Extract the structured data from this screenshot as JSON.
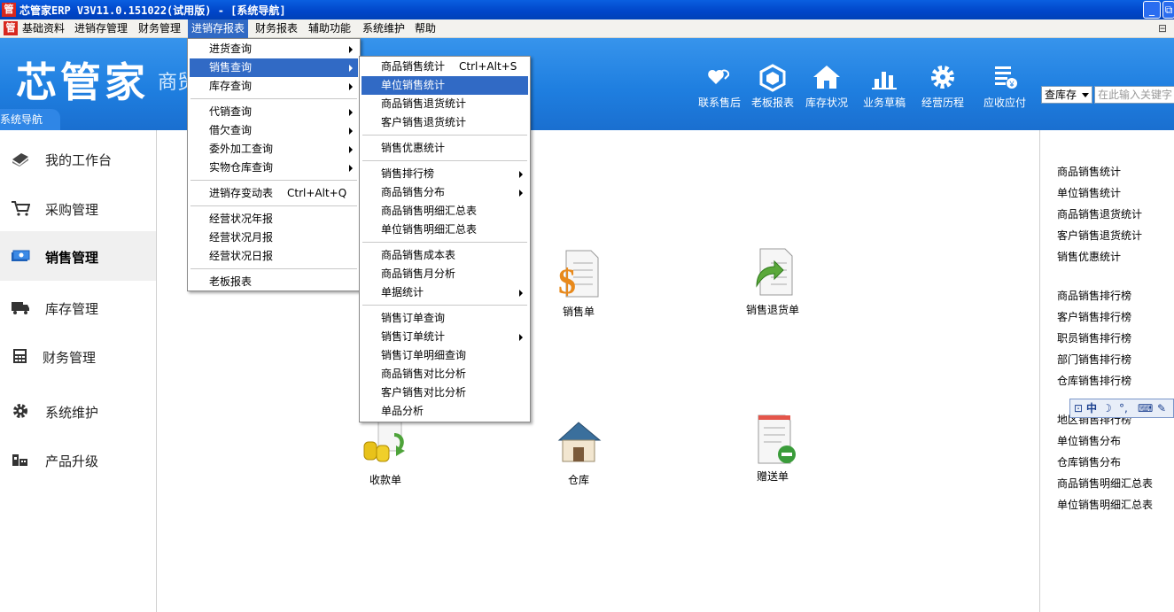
{
  "window": {
    "title": "芯管家ERP V3V11.0.151022(试用版) - [系统导航]",
    "app_icon_text": "管",
    "min_icon": "minimize-icon",
    "restore_icon": "restore-icon"
  },
  "menubar": {
    "items": [
      "基础资料",
      "进销存管理",
      "财务管理",
      "进销存报表",
      "财务报表",
      "辅助功能",
      "系统维护",
      "帮助"
    ],
    "active_index": 3,
    "mdi_controls": "⊟"
  },
  "banner": {
    "logo": "芯管家",
    "logo_sub": "商贸",
    "nav_tab": "系统导航",
    "toolbar": [
      {
        "label": "联系售后",
        "icon": "heart-support-icon"
      },
      {
        "label": "老板报表",
        "icon": "boss-report-icon"
      },
      {
        "label": "库存状况",
        "icon": "house-icon"
      },
      {
        "label": "业务草稿",
        "icon": "bar-chart-icon"
      },
      {
        "label": "经营历程",
        "icon": "gear-icon"
      },
      {
        "label": "应收应付",
        "icon": "receivable-icon"
      }
    ],
    "search": {
      "select_value": "查库存",
      "placeholder": "在此输入关键字"
    }
  },
  "sidebar": {
    "items": [
      {
        "label": "我的工作台",
        "icon": "workbench-icon"
      },
      {
        "label": "采购管理",
        "icon": "cart-icon"
      },
      {
        "label": "销售管理",
        "icon": "sales-icon"
      },
      {
        "label": "库存管理",
        "icon": "truck-icon"
      },
      {
        "label": "财务管理",
        "icon": "calculator-icon"
      },
      {
        "label": "系统维护",
        "icon": "gear-icon"
      },
      {
        "label": "产品升级",
        "icon": "upgrade-icon"
      }
    ],
    "active_index": 2
  },
  "main": {
    "tiles": [
      {
        "label": "销售单",
        "icon": "dollar-document-icon"
      },
      {
        "label": "销售退货单",
        "icon": "return-document-icon"
      },
      {
        "label": "收款单",
        "icon": "coins-icon"
      },
      {
        "label": "仓库",
        "icon": "warehouse-icon"
      },
      {
        "label": "赠送单",
        "icon": "gift-document-icon"
      }
    ]
  },
  "right_panel": {
    "links": [
      "商品销售统计",
      "单位销售统计",
      "商品销售退货统计",
      "客户销售退货统计",
      "销售优惠统计",
      "商品销售排行榜",
      "客户销售排行榜",
      "职员销售排行榜",
      "部门销售排行榜",
      "仓库销售排行榜",
      "地区销售排行榜",
      "单位销售分布",
      "仓库销售分布",
      "商品销售明细汇总表",
      "单位销售明细汇总表"
    ]
  },
  "ime": {
    "label": "中",
    "icons": [
      "ime-logo-icon",
      "moon-icon",
      "punct-icon",
      "keyboard-icon",
      "wrench-icon"
    ]
  },
  "report_menu": {
    "items": [
      {
        "label": "进货查询",
        "sub": true
      },
      {
        "label": "销售查询",
        "sub": true,
        "highlight": true
      },
      {
        "label": "库存查询",
        "sub": true
      },
      {
        "sep": true
      },
      {
        "label": "代销查询",
        "sub": true
      },
      {
        "label": "借欠查询",
        "sub": true
      },
      {
        "label": "委外加工查询",
        "sub": true
      },
      {
        "label": "实物仓库查询",
        "sub": true
      },
      {
        "sep": true
      },
      {
        "label": "进销存变动表",
        "shortcut": "Ctrl+Alt+Q"
      },
      {
        "sep": true
      },
      {
        "label": "经营状况年报"
      },
      {
        "label": "经营状况月报"
      },
      {
        "label": "经营状况日报"
      },
      {
        "sep": true
      },
      {
        "label": "老板报表"
      }
    ]
  },
  "sales_menu": {
    "items": [
      {
        "label": "商品销售统计",
        "shortcut": "Ctrl+Alt+S"
      },
      {
        "label": "单位销售统计",
        "highlight": true
      },
      {
        "label": "商品销售退货统计"
      },
      {
        "label": "客户销售退货统计"
      },
      {
        "sep": true
      },
      {
        "label": "销售优惠统计"
      },
      {
        "sep": true
      },
      {
        "label": "销售排行榜",
        "sub": true
      },
      {
        "label": "商品销售分布",
        "sub": true
      },
      {
        "label": "商品销售明细汇总表"
      },
      {
        "label": "单位销售明细汇总表"
      },
      {
        "sep": true
      },
      {
        "label": "商品销售成本表"
      },
      {
        "label": "商品销售月分析"
      },
      {
        "label": "单据统计",
        "sub": true
      },
      {
        "sep": true
      },
      {
        "label": "销售订单查询"
      },
      {
        "label": "销售订单统计",
        "sub": true
      },
      {
        "label": "销售订单明细查询"
      },
      {
        "label": "商品销售对比分析"
      },
      {
        "label": "客户销售对比分析"
      },
      {
        "label": "单品分析"
      }
    ]
  }
}
